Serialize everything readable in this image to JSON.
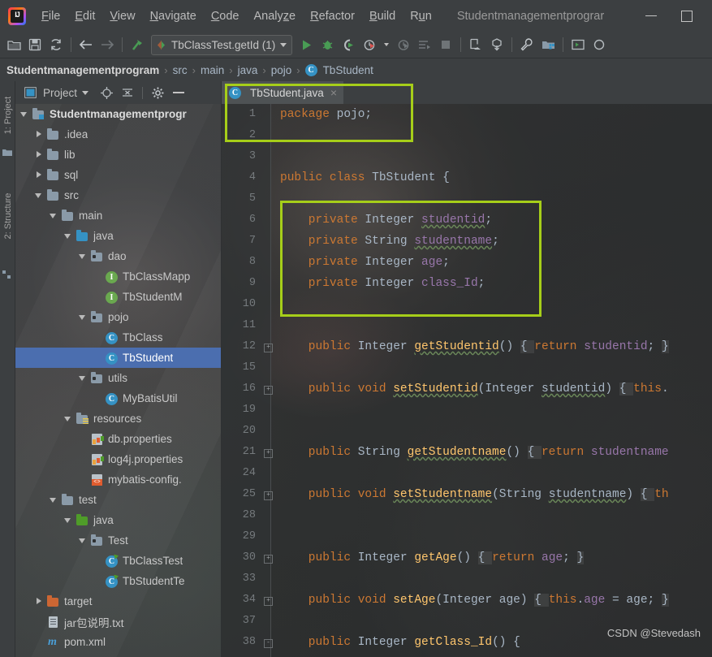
{
  "window": {
    "title": "Studentmanagementprograr",
    "minimize_label": "minimize",
    "maximize_label": "maximize"
  },
  "menubar": {
    "items": [
      {
        "label": "File",
        "mnemonic": "F"
      },
      {
        "label": "Edit",
        "mnemonic": "E"
      },
      {
        "label": "View",
        "mnemonic": "V"
      },
      {
        "label": "Navigate",
        "mnemonic": "N"
      },
      {
        "label": "Code",
        "mnemonic": "C"
      },
      {
        "label": "Analyze",
        "mnemonic": "z"
      },
      {
        "label": "Refactor",
        "mnemonic": "R"
      },
      {
        "label": "Build",
        "mnemonic": "B"
      },
      {
        "label": "Run",
        "mnemonic": "u"
      }
    ]
  },
  "toolbar": {
    "left_icons": [
      "open-folder-icon",
      "save-all-icon",
      "sync-icon",
      "back-arrow-icon",
      "forward-arrow-icon",
      "build-hammer-icon"
    ],
    "run_config": "TbClassTest.getId (1)",
    "right_icons": [
      "run-icon",
      "debug-icon",
      "run-coverage-icon",
      "profile-icon",
      "profile-dropdown-caret",
      "run-with-profiler-icon",
      "run-to-cursor-icon",
      "stop-icon",
      "update-app-icon",
      "package-download-icon",
      "settings-wrench-icon",
      "project-structure-icon",
      "terminal-icon"
    ]
  },
  "breadcrumb": {
    "items": [
      "Studentmanagementprogram",
      "src",
      "main",
      "java",
      "pojo",
      "TbStudent"
    ],
    "class_badge": "C",
    "separator": "›"
  },
  "tool_window_tabs": [
    {
      "label": "1: Project",
      "number": "1"
    },
    {
      "label": "2: Structure",
      "number": "2"
    }
  ],
  "project_panel": {
    "title": "Project",
    "icons": [
      "project-view-icon",
      "dropdown-caret",
      "locate-target-icon",
      "collapse-all-icon",
      "settings-gear-icon",
      "hide-panel-icon"
    ],
    "tree": [
      {
        "label": "Studentmanagementprogr",
        "indent": 0,
        "arrow": "open",
        "icon": "module-folder-icon",
        "bold": true,
        "selected": false
      },
      {
        "label": ".idea",
        "indent": 1,
        "arrow": "closed",
        "icon": "folder-icon",
        "bold": false,
        "selected": false
      },
      {
        "label": "lib",
        "indent": 1,
        "arrow": "closed",
        "icon": "folder-icon",
        "bold": false,
        "selected": false
      },
      {
        "label": "sql",
        "indent": 1,
        "arrow": "closed",
        "icon": "folder-icon",
        "bold": false,
        "selected": false
      },
      {
        "label": "src",
        "indent": 1,
        "arrow": "open",
        "icon": "folder-icon",
        "bold": false,
        "selected": false
      },
      {
        "label": "main",
        "indent": 2,
        "arrow": "open",
        "icon": "folder-icon",
        "bold": false,
        "selected": false
      },
      {
        "label": "java",
        "indent": 3,
        "arrow": "open",
        "icon": "source-folder-icon",
        "bold": false,
        "selected": false
      },
      {
        "label": "dao",
        "indent": 4,
        "arrow": "open",
        "icon": "package-icon",
        "bold": false,
        "selected": false
      },
      {
        "label": "TbClassMapp",
        "indent": 5,
        "arrow": "none",
        "icon": "interface-icon",
        "bold": false,
        "selected": false
      },
      {
        "label": "TbStudentM",
        "indent": 5,
        "arrow": "none",
        "icon": "interface-icon",
        "bold": false,
        "selected": false
      },
      {
        "label": "pojo",
        "indent": 4,
        "arrow": "open",
        "icon": "package-icon",
        "bold": false,
        "selected": false
      },
      {
        "label": "TbClass",
        "indent": 5,
        "arrow": "none",
        "icon": "class-icon",
        "bold": false,
        "selected": false
      },
      {
        "label": "TbStudent",
        "indent": 5,
        "arrow": "none",
        "icon": "class-icon",
        "bold": false,
        "selected": true
      },
      {
        "label": "utils",
        "indent": 4,
        "arrow": "open",
        "icon": "package-icon",
        "bold": false,
        "selected": false
      },
      {
        "label": "MyBatisUtil",
        "indent": 5,
        "arrow": "none",
        "icon": "class-icon",
        "bold": false,
        "selected": false
      },
      {
        "label": "resources",
        "indent": 3,
        "arrow": "open",
        "icon": "resources-folder-icon",
        "bold": false,
        "selected": false
      },
      {
        "label": "db.properties",
        "indent": 4,
        "arrow": "none",
        "icon": "properties-file-icon",
        "bold": false,
        "selected": false
      },
      {
        "label": "log4j.properties",
        "indent": 4,
        "arrow": "none",
        "icon": "properties-file-icon",
        "bold": false,
        "selected": false
      },
      {
        "label": "mybatis-config.",
        "indent": 4,
        "arrow": "none",
        "icon": "xml-file-icon",
        "bold": false,
        "selected": false
      },
      {
        "label": "test",
        "indent": 2,
        "arrow": "open",
        "icon": "folder-icon",
        "bold": false,
        "selected": false
      },
      {
        "label": "java",
        "indent": 3,
        "arrow": "open",
        "icon": "test-source-folder-icon",
        "bold": false,
        "selected": false
      },
      {
        "label": "Test",
        "indent": 4,
        "arrow": "open",
        "icon": "package-icon",
        "bold": false,
        "selected": false
      },
      {
        "label": "TbClassTest",
        "indent": 5,
        "arrow": "none",
        "icon": "test-class-icon",
        "bold": false,
        "selected": false
      },
      {
        "label": "TbStudentTe",
        "indent": 5,
        "arrow": "none",
        "icon": "test-class-icon",
        "bold": false,
        "selected": false
      },
      {
        "label": "target",
        "indent": 1,
        "arrow": "closed",
        "icon": "excluded-folder-icon",
        "bold": false,
        "selected": false
      },
      {
        "label": "jar包说明.txt",
        "indent": 1,
        "arrow": "none",
        "icon": "text-file-icon",
        "bold": false,
        "selected": false
      },
      {
        "label": "pom.xml",
        "indent": 1,
        "arrow": "none",
        "icon": "maven-file-icon",
        "bold": false,
        "selected": false
      }
    ]
  },
  "editor": {
    "tab": {
      "label": "TbStudent.java",
      "badge": "C",
      "close": "×"
    },
    "lines": [
      {
        "no": "1",
        "fold": "",
        "segments": [
          {
            "t": "package ",
            "c": "kw"
          },
          {
            "t": "pojo;",
            "c": "pl"
          }
        ]
      },
      {
        "no": "2",
        "fold": "",
        "segments": []
      },
      {
        "no": "3",
        "fold": "",
        "segments": []
      },
      {
        "no": "4",
        "fold": "",
        "segments": [
          {
            "t": "public class ",
            "c": "kw"
          },
          {
            "t": "TbStudent ",
            "c": "type"
          },
          {
            "t": "{",
            "c": "pl"
          }
        ]
      },
      {
        "no": "5",
        "fold": "",
        "segments": []
      },
      {
        "no": "6",
        "fold": "",
        "segments": [
          {
            "t": "    private ",
            "c": "kw"
          },
          {
            "t": "Integer ",
            "c": "type"
          },
          {
            "t": "studentid",
            "c": "fld2 wavy"
          },
          {
            "t": ";",
            "c": "pl"
          }
        ]
      },
      {
        "no": "7",
        "fold": "",
        "segments": [
          {
            "t": "    private ",
            "c": "kw"
          },
          {
            "t": "String ",
            "c": "type"
          },
          {
            "t": "studentname",
            "c": "fld2 wavy"
          },
          {
            "t": ";",
            "c": "pl"
          }
        ]
      },
      {
        "no": "8",
        "fold": "",
        "segments": [
          {
            "t": "    private ",
            "c": "kw"
          },
          {
            "t": "Integer ",
            "c": "type"
          },
          {
            "t": "age",
            "c": "fld2"
          },
          {
            "t": ";",
            "c": "pl"
          }
        ]
      },
      {
        "no": "9",
        "fold": "",
        "segments": [
          {
            "t": "    private ",
            "c": "kw"
          },
          {
            "t": "Integer ",
            "c": "type"
          },
          {
            "t": "class_Id",
            "c": "fld2"
          },
          {
            "t": ";",
            "c": "pl"
          }
        ]
      },
      {
        "no": "10",
        "fold": "",
        "segments": []
      },
      {
        "no": "11",
        "fold": "",
        "segments": []
      },
      {
        "no": "12",
        "fold": "+",
        "segments": [
          {
            "t": "    public ",
            "c": "kw"
          },
          {
            "t": "Integer ",
            "c": "type"
          },
          {
            "t": "getStudentid",
            "c": "mth wavy"
          },
          {
            "t": "() ",
            "c": "pl"
          },
          {
            "t": "{ ",
            "c": "brace"
          },
          {
            "t": "return ",
            "c": "kw"
          },
          {
            "t": "studentid",
            "c": "fld2"
          },
          {
            "t": "; ",
            "c": "pl"
          },
          {
            "t": "}",
            "c": "brace"
          }
        ]
      },
      {
        "no": "15",
        "fold": "",
        "segments": []
      },
      {
        "no": "16",
        "fold": "+",
        "segments": [
          {
            "t": "    public ",
            "c": "kw"
          },
          {
            "t": "void ",
            "c": "kw"
          },
          {
            "t": "setStudentid",
            "c": "mth wavy"
          },
          {
            "t": "(",
            "c": "pl"
          },
          {
            "t": "Integer ",
            "c": "type"
          },
          {
            "t": "studentid",
            "c": "pl wavy"
          },
          {
            "t": ") ",
            "c": "pl"
          },
          {
            "t": "{ ",
            "c": "brace"
          },
          {
            "t": "this",
            "c": "kw"
          },
          {
            "t": ".",
            "c": "pl"
          }
        ]
      },
      {
        "no": "19",
        "fold": "",
        "segments": []
      },
      {
        "no": "20",
        "fold": "",
        "segments": []
      },
      {
        "no": "21",
        "fold": "+",
        "segments": [
          {
            "t": "    public ",
            "c": "kw"
          },
          {
            "t": "String ",
            "c": "type"
          },
          {
            "t": "getStudentname",
            "c": "mth wavy"
          },
          {
            "t": "() ",
            "c": "pl"
          },
          {
            "t": "{ ",
            "c": "brace"
          },
          {
            "t": "return ",
            "c": "kw"
          },
          {
            "t": "studentname",
            "c": "fld2"
          }
        ]
      },
      {
        "no": "24",
        "fold": "",
        "segments": []
      },
      {
        "no": "25",
        "fold": "+",
        "segments": [
          {
            "t": "    public ",
            "c": "kw"
          },
          {
            "t": "void ",
            "c": "kw"
          },
          {
            "t": "setStudentname",
            "c": "mth wavy"
          },
          {
            "t": "(",
            "c": "pl"
          },
          {
            "t": "String ",
            "c": "type"
          },
          {
            "t": "studentname",
            "c": "pl wavy"
          },
          {
            "t": ") ",
            "c": "pl"
          },
          {
            "t": "{ ",
            "c": "brace"
          },
          {
            "t": "th",
            "c": "kw"
          }
        ]
      },
      {
        "no": "28",
        "fold": "",
        "segments": []
      },
      {
        "no": "29",
        "fold": "",
        "segments": []
      },
      {
        "no": "30",
        "fold": "+",
        "segments": [
          {
            "t": "    public ",
            "c": "kw"
          },
          {
            "t": "Integer ",
            "c": "type"
          },
          {
            "t": "getAge",
            "c": "mth"
          },
          {
            "t": "() ",
            "c": "pl"
          },
          {
            "t": "{ ",
            "c": "brace"
          },
          {
            "t": "return ",
            "c": "kw"
          },
          {
            "t": "age",
            "c": "fld2"
          },
          {
            "t": "; ",
            "c": "pl"
          },
          {
            "t": "}",
            "c": "brace"
          }
        ]
      },
      {
        "no": "33",
        "fold": "",
        "segments": []
      },
      {
        "no": "34",
        "fold": "+",
        "segments": [
          {
            "t": "    public ",
            "c": "kw"
          },
          {
            "t": "void ",
            "c": "kw"
          },
          {
            "t": "setAge",
            "c": "mth"
          },
          {
            "t": "(",
            "c": "pl"
          },
          {
            "t": "Integer ",
            "c": "type"
          },
          {
            "t": "age",
            "c": "pl"
          },
          {
            "t": ") ",
            "c": "pl"
          },
          {
            "t": "{ ",
            "c": "brace"
          },
          {
            "t": "this",
            "c": "kw"
          },
          {
            "t": ".",
            "c": "pl"
          },
          {
            "t": "age ",
            "c": "fld2"
          },
          {
            "t": "= age; ",
            "c": "pl"
          },
          {
            "t": "}",
            "c": "brace"
          }
        ]
      },
      {
        "no": "37",
        "fold": "",
        "segments": []
      },
      {
        "no": "38",
        "fold": "-",
        "segments": [
          {
            "t": "    public ",
            "c": "kw"
          },
          {
            "t": "Integer ",
            "c": "type"
          },
          {
            "t": "getClass_Id",
            "c": "mth"
          },
          {
            "t": "() ",
            "c": "pl"
          },
          {
            "t": "{",
            "c": "pl"
          }
        ]
      }
    ]
  },
  "watermark": "CSDN @Stevedash",
  "colors": {
    "highlight": "#a6ce19",
    "selection": "#4b6eaf",
    "editor_bg": "#2b2d2e",
    "chrome_bg": "#3c3f41",
    "keyword": "#cc7832",
    "method": "#ffc66d",
    "field": "#9876aa"
  }
}
